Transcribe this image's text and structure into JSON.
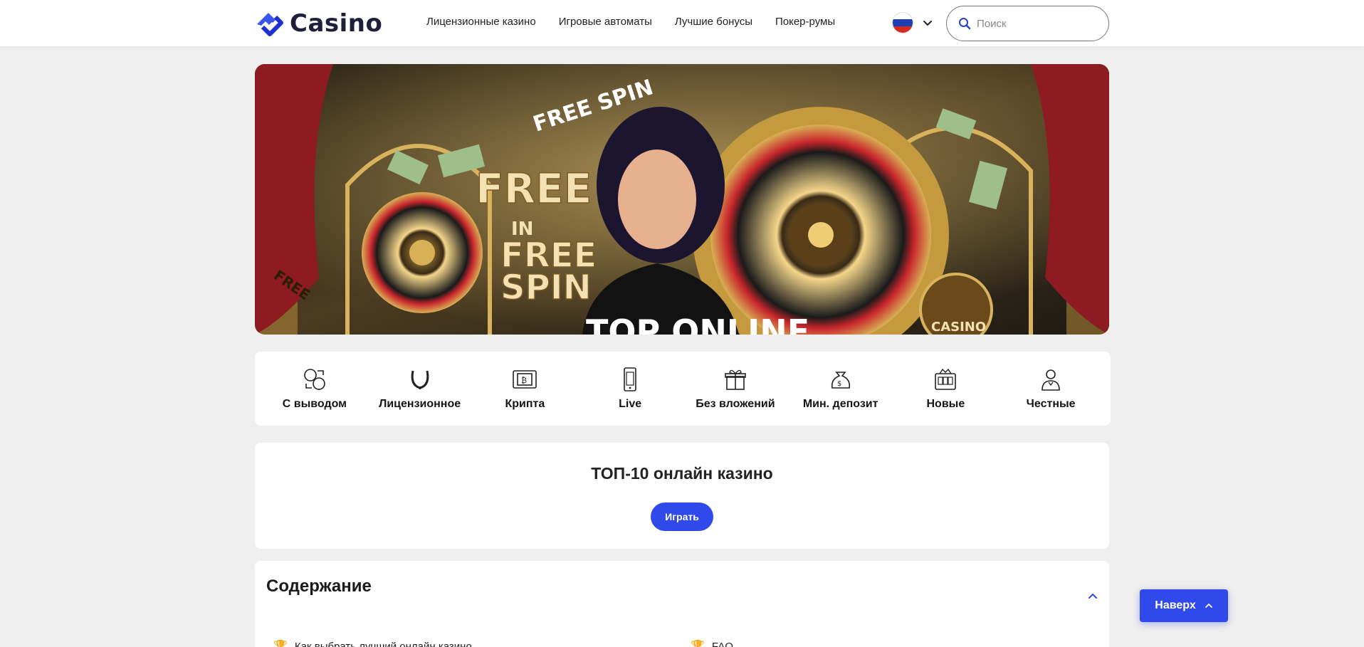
{
  "header": {
    "logo_text": "Casino",
    "nav": [
      {
        "label": "Лицензионные казино"
      },
      {
        "label": "Игровые автоматы"
      },
      {
        "label": "Лучшие бонусы"
      },
      {
        "label": "Покер-румы"
      }
    ],
    "language": {
      "flag": "ru",
      "icon": "chevron-down-icon"
    },
    "search": {
      "placeholder": "Поиск",
      "icon": "search-icon"
    }
  },
  "banner": {
    "texts": [
      "FREE SPIN",
      "FREE",
      "IN",
      "FREE",
      "SPIN",
      "TOP ONLINE",
      "FREE",
      "CASINO"
    ]
  },
  "categories": [
    {
      "label": "С выводом",
      "icon": "coins-exchange-icon"
    },
    {
      "label": "Лицензионное",
      "icon": "horseshoe-icon"
    },
    {
      "label": "Крипта",
      "icon": "crypto-wallet-icon"
    },
    {
      "label": "Live",
      "icon": "mobile-phone-icon"
    },
    {
      "label": "Без вложений",
      "icon": "gift-icon"
    },
    {
      "label": "Мин. депозит",
      "icon": "money-bag-icon"
    },
    {
      "label": "Новые",
      "icon": "slot-machine-icon"
    },
    {
      "label": "Честные",
      "icon": "dealer-icon"
    }
  ],
  "top10": {
    "title": "ТОП-10 онлайн казино",
    "button": "Играть"
  },
  "toc": {
    "title": "Содержание",
    "items": [
      {
        "label": "Как выбрать лучший онлайн казино",
        "icon": "trophy-icon"
      },
      {
        "label": "FAQ",
        "icon": "trophy-icon"
      }
    ]
  },
  "to_top": {
    "label": "Наверх"
  },
  "colors": {
    "accent": "#3049ea",
    "background": "#efefef"
  }
}
